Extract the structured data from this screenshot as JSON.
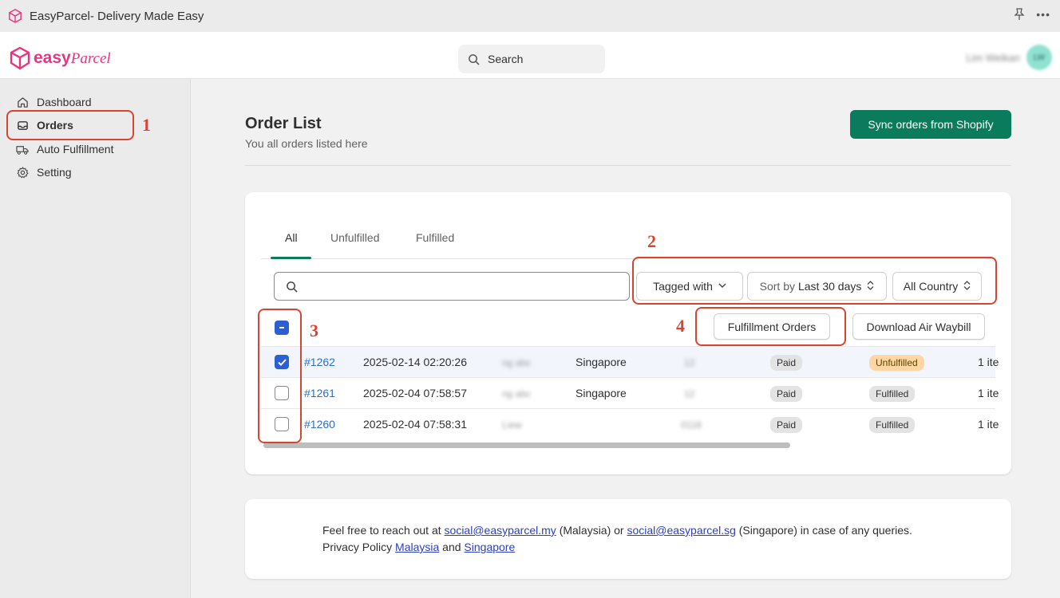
{
  "window": {
    "title": "EasyParcel- Delivery Made Easy"
  },
  "header": {
    "logo_word": "easy",
    "logo_script": "Parcel",
    "search_placeholder": "Search",
    "user_name": "Lim Weikan",
    "user_initials": "LW"
  },
  "sidebar": {
    "items": [
      {
        "label": "Dashboard",
        "icon": "home-icon"
      },
      {
        "label": "Orders",
        "icon": "inbox-icon"
      },
      {
        "label": "Auto Fulfillment",
        "icon": "truck-icon"
      },
      {
        "label": "Setting",
        "icon": "gear-icon"
      }
    ]
  },
  "page": {
    "title": "Order List",
    "subtitle": "You all orders listed here",
    "sync_button": "Sync orders from Shopify"
  },
  "tabs": [
    "All",
    "Unfulfilled",
    "Fulfilled"
  ],
  "filters": {
    "tagged_with": "Tagged with",
    "sort_prefix": "Sort by",
    "sort_value": "Last 30 days",
    "country": "All Country"
  },
  "actions": {
    "fulfillment_orders": "Fulfillment Orders",
    "download_air_waybill": "Download Air Waybill"
  },
  "orders": [
    {
      "id": "#1262",
      "date": "2025-02-14 02:20:26",
      "customer": "ng abc",
      "country": "Singapore",
      "code": "12",
      "payment": "Paid",
      "fulfillment": "Unfulfilled",
      "items": "1 ite",
      "selected": true
    },
    {
      "id": "#1261",
      "date": "2025-02-04 07:58:57",
      "customer": "ng abc",
      "country": "Singapore",
      "code": "12",
      "payment": "Paid",
      "fulfillment": "Fulfilled",
      "items": "1 ite",
      "selected": false
    },
    {
      "id": "#1260",
      "date": "2025-02-04 07:58:31",
      "customer": "Liew",
      "country": "",
      "code": "0118",
      "payment": "Paid",
      "fulfillment": "Fulfilled",
      "items": "1 ite",
      "selected": false
    }
  ],
  "annotations": [
    "1",
    "2",
    "3",
    "4"
  ],
  "footer": {
    "line1_prefix": "Feel free to reach out at",
    "email_my": "social@easyparcel.my",
    "line1_mid": "(Malaysia) or",
    "email_sg": "social@easyparcel.sg",
    "line1_suffix": "(Singapore) in case of any queries.",
    "line2_prefix": "Privacy Policy",
    "link_malaysia": "Malaysia",
    "line2_and": "and",
    "link_singapore": "Singapore"
  },
  "colors": {
    "accent_green": "#0a7c5b",
    "brand_pink": "#e8357f",
    "annotation_red": "#d64531",
    "checkbox_blue": "#2c5fcf"
  }
}
